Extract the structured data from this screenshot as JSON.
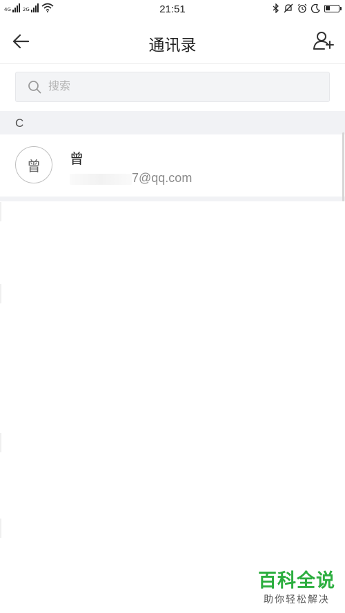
{
  "status_bar": {
    "network_1": "4G",
    "network_2": "2G",
    "time": "21:51",
    "battery_percent": 35
  },
  "header": {
    "title": "通讯录"
  },
  "search": {
    "placeholder": "搜索"
  },
  "contacts": {
    "section_letter": "C",
    "items": [
      {
        "avatar_char": "曾",
        "name": "曾",
        "email_visible": "7@qq.com"
      }
    ]
  },
  "watermark": {
    "main": "百科全说",
    "sub": "助你轻松解决"
  },
  "colors": {
    "watermark_green": "#2cae3f",
    "section_bg": "#f1f2f5",
    "search_bg": "#f3f4f6"
  }
}
